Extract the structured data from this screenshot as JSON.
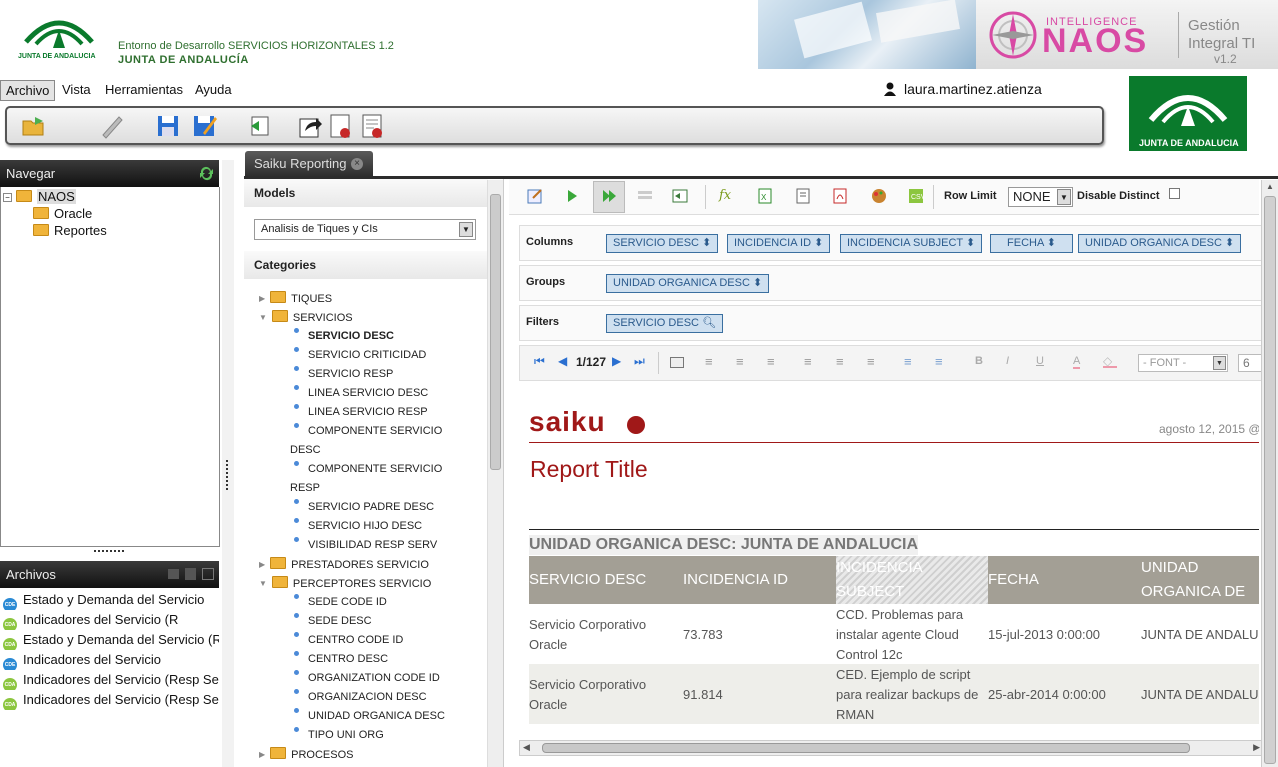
{
  "header": {
    "env_title": "Entorno de Desarrollo SERVICIOS HORIZONTALES 1.2",
    "org_title": "JUNTA DE ANDALUCÍA",
    "logo_caption": "JUNTA DE ANDALUCIA",
    "naos_intelligence": "INTELLIGENCE",
    "naos_name": "NAOS",
    "gestion_line1": "Gestión",
    "gestion_line2": "Integral TI",
    "gestion_version": "v1.2"
  },
  "menu": [
    "Archivo",
    "Vista",
    "Herramientas",
    "Ayuda"
  ],
  "user": {
    "name": "laura.martinez.atienza"
  },
  "navegar": {
    "title": "Navegar",
    "tree": [
      {
        "label": "NAOS",
        "level": 0,
        "selected": true
      },
      {
        "label": "Oracle",
        "level": 1
      },
      {
        "label": "Reportes",
        "level": 1
      }
    ]
  },
  "archivos": {
    "title": "Archivos",
    "items": [
      {
        "label": "Estado y Demanda del Servicio",
        "color": "#2a8ad4"
      },
      {
        "label": "Indicadores del Servicio (R",
        "color": "#8cc63f"
      },
      {
        "label": "Estado y Demanda del Servicio (R",
        "color": "#8cc63f"
      },
      {
        "label": "Indicadores del Servicio",
        "color": "#2a8ad4"
      },
      {
        "label": "Indicadores del Servicio (Resp Ser",
        "color": "#8cc63f"
      },
      {
        "label": "Indicadores del Servicio (Resp Ser",
        "color": "#8cc63f"
      }
    ]
  },
  "tab": {
    "label": "Saiku Reporting"
  },
  "models": {
    "title": "Models",
    "selected": "Analisis de Tiques y CIs"
  },
  "categories": {
    "title": "Categories",
    "rows": [
      {
        "label": "TIQUES",
        "type": "folder",
        "open": false
      },
      {
        "label": "SERVICIOS",
        "type": "folder",
        "open": true
      },
      {
        "label": "SERVICIO DESC",
        "type": "field",
        "bold": true
      },
      {
        "label": "SERVICIO CRITICIDAD",
        "type": "field"
      },
      {
        "label": "SERVICIO RESP",
        "type": "field"
      },
      {
        "label": "LINEA SERVICIO DESC",
        "type": "field"
      },
      {
        "label": "LINEA SERVICIO RESP",
        "type": "field"
      },
      {
        "label": "COMPONENTE SERVICIO",
        "type": "field"
      },
      {
        "label": "DESC",
        "type": "wrap"
      },
      {
        "label": "COMPONENTE SERVICIO",
        "type": "field"
      },
      {
        "label": "RESP",
        "type": "wrap"
      },
      {
        "label": "SERVICIO PADRE DESC",
        "type": "field"
      },
      {
        "label": "SERVICIO HIJO DESC",
        "type": "field"
      },
      {
        "label": "VISIBILIDAD RESP SERV",
        "type": "field"
      },
      {
        "label": "PRESTADORES SERVICIO",
        "type": "folder",
        "open": false
      },
      {
        "label": "PERCEPTORES SERVICIO",
        "type": "folder",
        "open": true
      },
      {
        "label": "SEDE CODE ID",
        "type": "field"
      },
      {
        "label": "SEDE DESC",
        "type": "field"
      },
      {
        "label": "CENTRO CODE ID",
        "type": "field"
      },
      {
        "label": "CENTRO DESC",
        "type": "field"
      },
      {
        "label": "ORGANIZATION CODE ID",
        "type": "field"
      },
      {
        "label": "ORGANIZACION DESC",
        "type": "field"
      },
      {
        "label": "UNIDAD ORGANICA DESC",
        "type": "field"
      },
      {
        "label": "TIPO UNI ORG",
        "type": "field"
      },
      {
        "label": "PROCESOS",
        "type": "folder",
        "open": false
      }
    ]
  },
  "toolbar_right": {
    "row_limit_label": "Row Limit",
    "row_limit_value": "NONE",
    "disable_distinct_label": "Disable Distinct"
  },
  "axes": {
    "columns_label": "Columns",
    "columns": [
      "SERVICIO DESC",
      "INCIDENCIA ID",
      "INCIDENCIA SUBJECT",
      "FECHA",
      "UNIDAD ORGANICA DESC"
    ],
    "groups_label": "Groups",
    "groups": [
      "UNIDAD ORGANICA DESC"
    ],
    "filters_label": "Filters",
    "filters": [
      "SERVICIO DESC"
    ]
  },
  "pager": {
    "page": "1/127",
    "font_placeholder": "- FONT -",
    "font_size": "6"
  },
  "report": {
    "brand": "saiku",
    "date": "agosto 12, 2015 @",
    "title": "Report Title",
    "group_header": "UNIDAD ORGANICA DESC: JUNTA DE ANDALUCIA",
    "columns": [
      "SERVICIO DESC",
      "INCIDENCIA ID",
      "INCIDENCIA SUBJECT",
      "FECHA",
      "UNIDAD ORGANICA  DE"
    ],
    "rows": [
      {
        "servicio": "Servicio Corporativo Oracle",
        "id": "73.783",
        "subject": "CCD. Problemas para instalar agente Cloud Control 12c",
        "fecha": "15-jul-2013 0:00:00",
        "unidad": "JUNTA DE ANDALU"
      },
      {
        "servicio": "Servicio Corporativo Oracle",
        "id": "91.814",
        "subject": "CED. Ejemplo de script para realizar backups  de RMAN",
        "fecha": "25-abr-2014 0:00:00",
        "unidad": "JUNTA DE ANDALU"
      }
    ]
  }
}
